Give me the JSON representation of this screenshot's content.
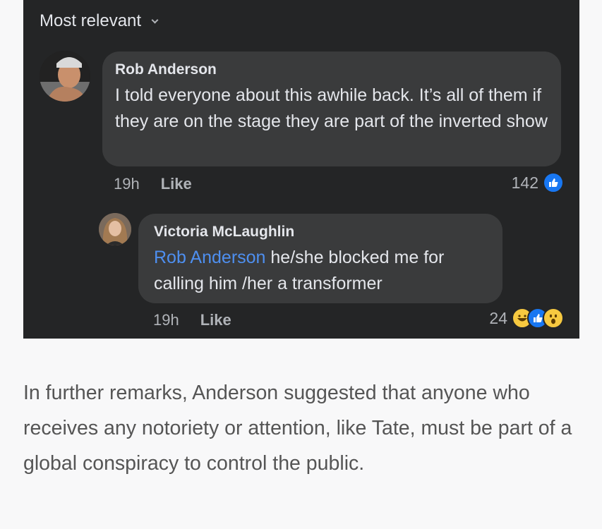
{
  "sort": {
    "label": "Most relevant"
  },
  "comments": [
    {
      "author": "Rob Anderson",
      "text": "I told everyone about this awhile back. It’s all of them if they are on the stage they are part of the inverted show",
      "time": "19h",
      "like_label": "Like",
      "reaction_count": "142",
      "reactions": [
        "like-icon"
      ]
    },
    {
      "author": "Victoria McLaughlin",
      "mention": "Rob Anderson",
      "text": "he/she  blocked me for calling him /her a transformer",
      "time": "19h",
      "like_label": "Like",
      "reaction_count": "24",
      "reactions": [
        "haha-icon",
        "like-icon",
        "wow-icon"
      ]
    }
  ],
  "article": {
    "text": "In further remarks, Anderson suggested that anyone who receives any notoriety or attention, like Tate, must be part of a global conspiracy to control the public."
  },
  "colors": {
    "panel_bg": "#242526",
    "bubble_bg": "#3a3b3c",
    "mention": "#4e8ff0",
    "like_blue": "#1877f2",
    "page_bg": "#f8f8f9"
  }
}
